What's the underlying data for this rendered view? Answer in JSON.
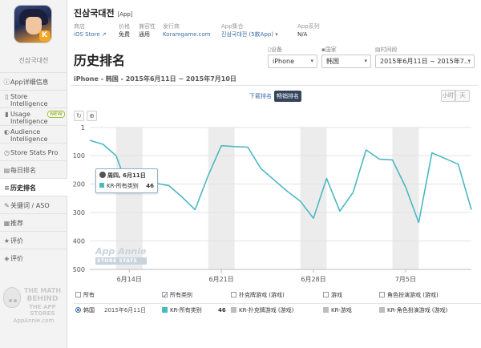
{
  "app": {
    "name": "진삼국대전",
    "tag": "[App]",
    "sidebar_name": "진삼국대전",
    "store_label": "商店",
    "store_value": "iOS Store",
    "price_label": "价格",
    "price_value": "免费",
    "compat_label": "兼容性",
    "compat_value": "通用",
    "publisher_label": "发行商",
    "publisher_value": "Koramgame.com",
    "collection_label": "App集合",
    "collection_value": "진삼국대전 (5款App)",
    "series_label": "App系列",
    "series_value": "N/A"
  },
  "sidebar": {
    "items": [
      {
        "icon": "info-icon",
        "glyph": "ⓘ",
        "label": "App详细信息"
      },
      {
        "icon": "store-intelligence-icon",
        "glyph": "▯",
        "label": "Store Intelligence"
      },
      {
        "icon": "usage-intelligence-icon",
        "glyph": "▮",
        "label": "Usage Intelligence",
        "badge": "NEW"
      },
      {
        "icon": "audience-intelligence-icon",
        "glyph": "◐",
        "label": "Audience Intelligence"
      },
      {
        "icon": "clock-icon",
        "glyph": "◷",
        "label": "Store Stats Pro"
      },
      {
        "icon": "calendar-icon",
        "glyph": "▤",
        "label": "每日排名"
      },
      {
        "icon": "ranking-icon",
        "glyph": "≡",
        "label": "历史排名"
      },
      {
        "icon": "keyword-icon",
        "glyph": "✎",
        "label": "关键词 / ASO"
      },
      {
        "icon": "featured-icon",
        "glyph": "▦",
        "label": "推荐"
      },
      {
        "icon": "star-icon",
        "glyph": "★",
        "label": "评价"
      },
      {
        "icon": "comment-icon",
        "glyph": "◈",
        "label": "评价"
      }
    ],
    "mascot": {
      "line1": "THE MATH",
      "line2": "BEHIND",
      "line3": "THE APP STORES",
      "site": "AppAnnie.com"
    }
  },
  "page": {
    "title": "历史排名",
    "subtitle": "iPhone - 韩国 - 2015年6月11日 ~ 2015年7月10日"
  },
  "filters": {
    "device_label": "设备",
    "device_value": "iPhone",
    "country_label": "国家",
    "country_value": "韩国",
    "period_label": "时间段",
    "period_value": "2015年6月11日 ~ 2015年7..."
  },
  "rank_tabs": {
    "download": "下载排名",
    "grossing": "畅销排名"
  },
  "period_buttons": {
    "day": "小时",
    "week": "天"
  },
  "tools": {
    "reset": "↻",
    "zoom": "🔍"
  },
  "watermark": {
    "brand": "App Annie",
    "sub": "STORE STATS"
  },
  "tooltip": {
    "date": "周四, 6月11日",
    "series": "KR-所有类别",
    "value": "46"
  },
  "legend": {
    "headers": {
      "all": "所有",
      "all_categories": "所有类别",
      "poker": "扑克牌游戏 (游戏)",
      "games": "游戏",
      "rpg": "角色扮演游戏 (游戏)"
    },
    "row": {
      "country": "韩国",
      "date": "2015年6月11日",
      "s1_name": "KR-所有类别",
      "s1_value": "46",
      "s2_name": "KR-扑克牌游戏 (游戏)",
      "s3_name": "KR-游戏",
      "s4_name": "KR-角色扮演游戏 (游戏)"
    }
  },
  "colors": {
    "series": "#4bb8c2",
    "accent": "#33445c",
    "link": "#3a6ea5",
    "band": "#ececec"
  },
  "chart_data": {
    "type": "line",
    "y_inverted": true,
    "ylim": [
      1,
      500
    ],
    "yticks": [
      1,
      100,
      200,
      300,
      400,
      500
    ],
    "x_tick_labels": [
      "6月14日",
      "6月21日",
      "6月28日",
      "7月5日"
    ],
    "x_tick_days": [
      3,
      10,
      17,
      24
    ],
    "weekend_bands_days": [
      [
        2,
        4
      ],
      [
        9,
        11
      ],
      [
        16,
        18
      ],
      [
        23,
        25
      ]
    ],
    "x": [
      "2015-06-11",
      "2015-06-12",
      "2015-06-13",
      "2015-06-14",
      "2015-06-15",
      "2015-06-16",
      "2015-06-17",
      "2015-06-18",
      "2015-06-19",
      "2015-06-20",
      "2015-06-21",
      "2015-06-22",
      "2015-06-23",
      "2015-06-24",
      "2015-06-25",
      "2015-06-26",
      "2015-06-27",
      "2015-06-28",
      "2015-06-29",
      "2015-06-30",
      "2015-07-01",
      "2015-07-02",
      "2015-07-03",
      "2015-07-04",
      "2015-07-05",
      "2015-07-06",
      "2015-07-07",
      "2015-07-08",
      "2015-07-09",
      "2015-07-10"
    ],
    "series": [
      {
        "name": "KR-所有类别",
        "values": [
          46,
          60,
          100,
          225,
          198,
          197,
          205,
          245,
          290,
          170,
          65,
          68,
          70,
          145,
          185,
          225,
          260,
          320,
          180,
          295,
          230,
          80,
          112,
          115,
          210,
          335,
          90,
          110,
          130,
          290
        ]
      }
    ]
  }
}
